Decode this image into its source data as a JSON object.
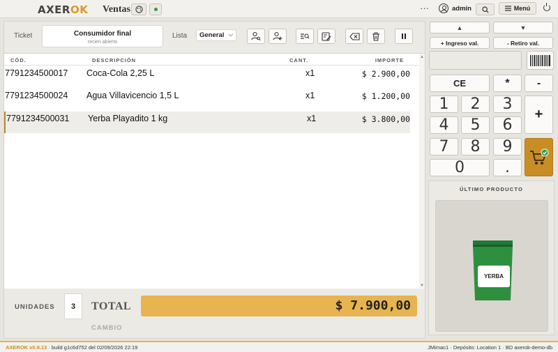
{
  "app": {
    "logo_prefix": "AXER",
    "logo_suffix": "OK",
    "module_title": "Ventas",
    "user": "admin",
    "menu_label": "Menú"
  },
  "ticket": {
    "label": "Ticket",
    "customer_name": "Consumidor final",
    "customer_status": "recien abierto",
    "list_label": "Lista",
    "list_value": "General"
  },
  "table": {
    "headers": {
      "code": "CÓD.",
      "description": "DESCRIPCIÓN",
      "quantity": "CANT.",
      "amount": "IMPORTE"
    },
    "rows": [
      {
        "code": "7791234500017",
        "description": "Coca-Cola 2,25 L",
        "qty": "x1",
        "amount": "$ 2.900,00"
      },
      {
        "code": "7791234500024",
        "description": "Agua Villavicencio 1,5 L",
        "qty": "x1",
        "amount": "$ 1.200,00"
      },
      {
        "code": "7791234500031",
        "description": "Yerba Playadito 1 kg",
        "qty": "x1",
        "amount": "$ 3.800,00"
      }
    ]
  },
  "totals": {
    "units_label": "UNIDADES",
    "units_value": "3",
    "total_label": "TOTAL",
    "total_value": "$ 7.900,00",
    "change_label": "CAMBIO"
  },
  "keypad": {
    "cash_in": "+ Ingreso val.",
    "cash_out": "- Retiro val.",
    "clear": "CE",
    "multiply": "*",
    "minus": "-",
    "plus": "+",
    "digits": [
      "1",
      "2",
      "3",
      "4",
      "5",
      "6",
      "7",
      "8",
      "9",
      "0",
      "."
    ]
  },
  "last_product": {
    "title": "ÚLTIMO PRODUCTO",
    "label": "YERBA"
  },
  "status_bar": {
    "version": "AXEROK v0.9.13",
    "build": "· build g1c6d752 del 02/09/2026 22:19",
    "right": "JMimac1 · Depósito: Location 1 · BD axerok-demo-db"
  },
  "colors": {
    "accent": "#c98d26",
    "total_bg": "#e8b44f",
    "status_ok": "#2e9b47"
  }
}
